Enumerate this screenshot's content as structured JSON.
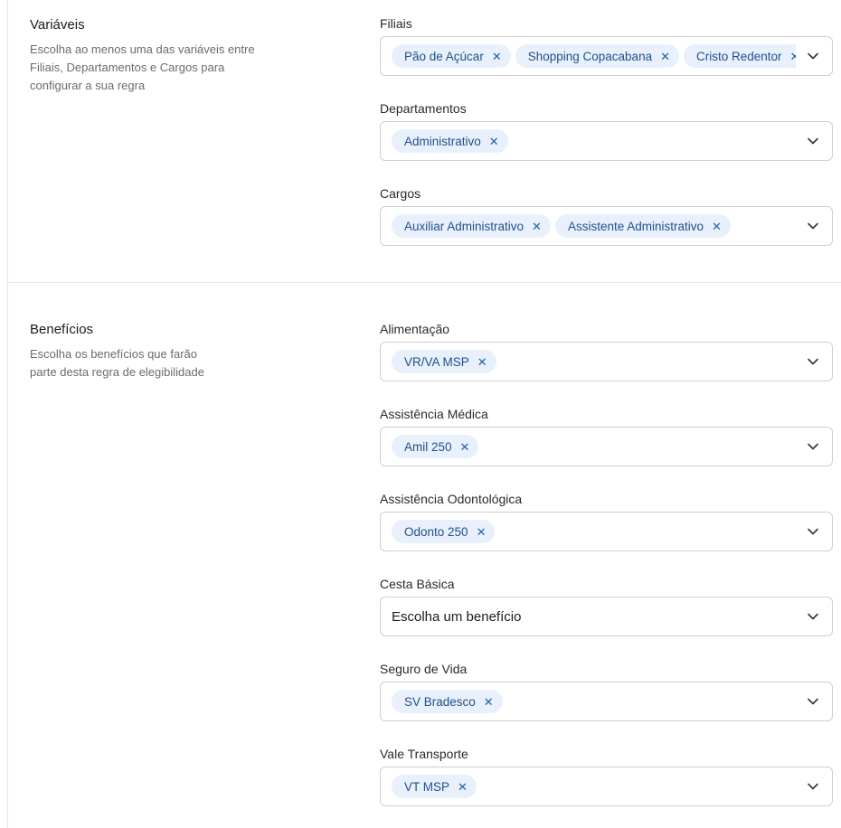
{
  "variables": {
    "title": "Variáveis",
    "description": "Escolha ao menos uma das variáveis entre Filiais, Departamentos e Cargos para configurar a sua regra",
    "fields": {
      "filiais": {
        "label": "Filiais",
        "chips": [
          "Pão de Açúcar",
          "Shopping Copacabana",
          "Cristo Redentor"
        ]
      },
      "departamentos": {
        "label": "Departamentos",
        "chips": [
          "Administrativo"
        ]
      },
      "cargos": {
        "label": "Cargos",
        "chips": [
          "Auxiliar Administrativo",
          "Assistente Administrativo"
        ]
      }
    }
  },
  "benefits": {
    "title": "Benefícios",
    "description": "Escolha os benefícios que farão parte desta regra de elegibilidade",
    "fields": {
      "alimentacao": {
        "label": "Alimentação",
        "chips": [
          "VR/VA MSP"
        ]
      },
      "medica": {
        "label": "Assistência Médica",
        "chips": [
          "Amil 250"
        ]
      },
      "odonto": {
        "label": "Assistência Odontológica",
        "chips": [
          "Odonto 250"
        ]
      },
      "cesta": {
        "label": "Cesta Básica",
        "placeholder": "Escolha um benefício"
      },
      "seguro": {
        "label": "Seguro de Vida",
        "chips": [
          "SV Bradesco"
        ]
      },
      "transporte": {
        "label": "Vale Transporte",
        "chips": [
          "VT MSP"
        ]
      }
    }
  },
  "icons": {
    "remove": "close-icon",
    "dropdown": "chevron-down-icon"
  },
  "colors": {
    "chip_bg": "#e8f1fb",
    "chip_text": "#1f4f8f",
    "border": "#cfcfcf"
  }
}
